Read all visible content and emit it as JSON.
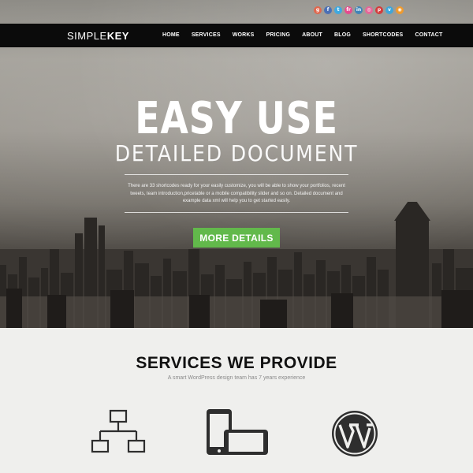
{
  "social": {
    "items": [
      {
        "name": "googleplus-icon",
        "glyph": "g",
        "color": "#e0674e"
      },
      {
        "name": "facebook-icon",
        "glyph": "f",
        "color": "#4a6fb5"
      },
      {
        "name": "twitter-icon",
        "glyph": "t",
        "color": "#3fa9e0"
      },
      {
        "name": "flickr-icon",
        "glyph": "fr",
        "color": "#e64a8e"
      },
      {
        "name": "linkedin-icon",
        "glyph": "in",
        "color": "#3f84b8"
      },
      {
        "name": "dribbble-icon",
        "glyph": "◎",
        "color": "#e46798"
      },
      {
        "name": "pinterest-icon",
        "glyph": "p",
        "color": "#d43b3b"
      },
      {
        "name": "vimeo-icon",
        "glyph": "v",
        "color": "#3fa6d9"
      },
      {
        "name": "rss-icon",
        "glyph": "◉",
        "color": "#ef9a2e"
      }
    ]
  },
  "nav": {
    "logo_light": "SIMPLE",
    "logo_bold": "KEY",
    "items": [
      "HOME",
      "SERVICES",
      "WORKS",
      "PRICING",
      "ABOUT",
      "BLOG",
      "SHORTCODES",
      "CONTACT"
    ]
  },
  "hero": {
    "title": "EASY USE",
    "subtitle": "DETAILED DOCUMENT",
    "description": "There are 33 shortcodes ready for your easily customize, you will be able to show your portfolios, recent tweets, team introduction,pricetable or a mobile compatibility slider and so on. Detailed document and example data xml will help you to get started easily.",
    "cta_label": "MORE DETAILS"
  },
  "services": {
    "title": "SERVICES WE PROVIDE",
    "subtitle": "A smart WordPress design team has 7 years experience",
    "icons": [
      "sitemap-icon",
      "mobile-devices-icon",
      "wordpress-icon"
    ]
  },
  "colors": {
    "nav_bg": "#0b0b0b",
    "cta_green": "#62b94b",
    "page_bg": "#efefed"
  }
}
